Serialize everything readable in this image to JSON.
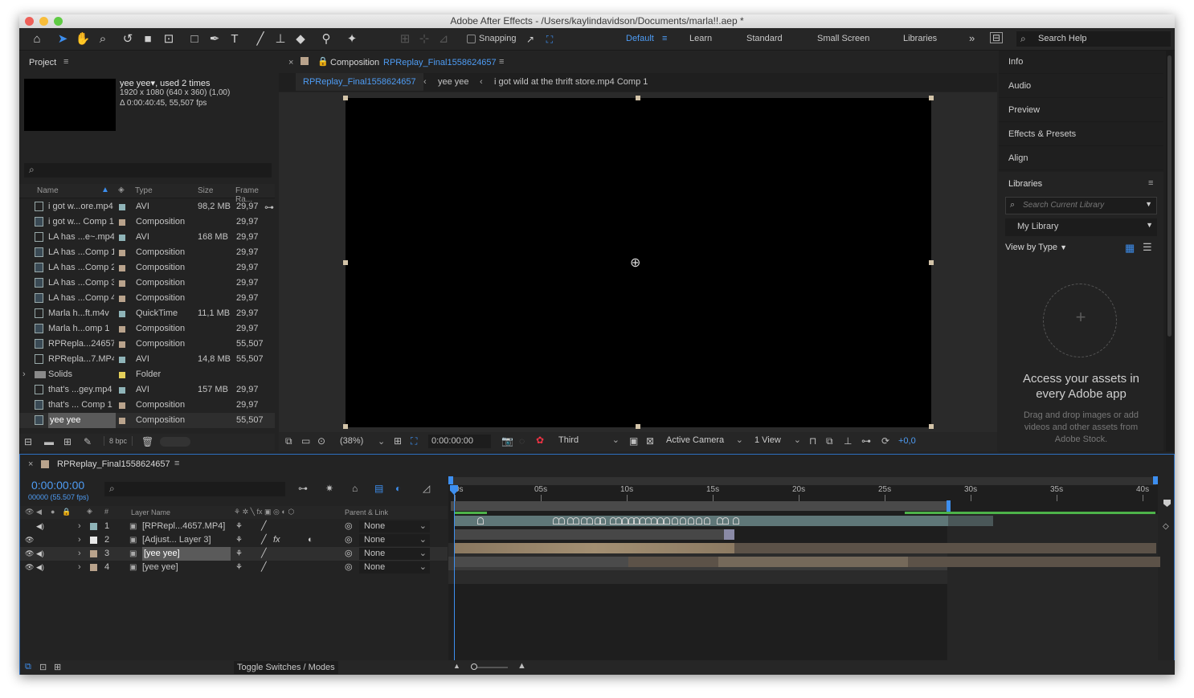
{
  "window": {
    "title": "Adobe After Effects - /Users/kaylindavidson/Documents/marla!!.aep *"
  },
  "toolbar": {
    "snapping_label": "Snapping",
    "workspaces": [
      "Default",
      "Learn",
      "Standard",
      "Small Screen",
      "Libraries"
    ],
    "search_help_placeholder": "Search Help"
  },
  "project": {
    "tab_label": "Project",
    "preview": {
      "name": "yee yee",
      "used": ", used 2 times",
      "dims": "1920 x 1080  (640 x 360) (1,00)",
      "duration": "Δ 0:00:40:45, 55,507 fps"
    },
    "search_placeholder": "",
    "columns": [
      "Name",
      "Type",
      "Size",
      "Frame Ra..."
    ],
    "items": [
      {
        "name": "i got w...ore.mp4",
        "type": "AVI",
        "size": "98,2 MB",
        "fps": "29,97",
        "swatch": "#8fb4b8"
      },
      {
        "name": "i got w... Comp 1",
        "type": "Composition",
        "size": "",
        "fps": "29,97",
        "swatch": "#b9a38c"
      },
      {
        "name": "LA has ...e~.mp4",
        "type": "AVI",
        "size": "168 MB",
        "fps": "29,97",
        "swatch": "#8fb4b8"
      },
      {
        "name": "LA has ...Comp 1",
        "type": "Composition",
        "size": "",
        "fps": "29,97",
        "swatch": "#b9a38c"
      },
      {
        "name": "LA has ...Comp 2",
        "type": "Composition",
        "size": "",
        "fps": "29,97",
        "swatch": "#b9a38c"
      },
      {
        "name": "LA has ...Comp 3",
        "type": "Composition",
        "size": "",
        "fps": "29,97",
        "swatch": "#b9a38c"
      },
      {
        "name": "LA has ...Comp 4",
        "type": "Composition",
        "size": "",
        "fps": "29,97",
        "swatch": "#b9a38c"
      },
      {
        "name": "Marla h...ft.m4v",
        "type": "QuickTime",
        "size": "11,1 MB",
        "fps": "29,97",
        "swatch": "#8fb4b8"
      },
      {
        "name": "Marla h...omp 1",
        "type": "Composition",
        "size": "",
        "fps": "29,97",
        "swatch": "#b9a38c"
      },
      {
        "name": "RPRepla...24657",
        "type": "Composition",
        "size": "",
        "fps": "55,507",
        "swatch": "#b9a38c"
      },
      {
        "name": "RPRepla...7.MP4",
        "type": "AVI",
        "size": "14,8 MB",
        "fps": "55,507",
        "swatch": "#8fb4b8"
      },
      {
        "name": "Solids",
        "type": "Folder",
        "size": "",
        "fps": "",
        "swatch": "#e3cf5a"
      },
      {
        "name": "that's ...gey.mp4",
        "type": "AVI",
        "size": "157 MB",
        "fps": "29,97",
        "swatch": "#8fb4b8"
      },
      {
        "name": "that's ... Comp 1",
        "type": "Composition",
        "size": "",
        "fps": "29,97",
        "swatch": "#b9a38c"
      },
      {
        "name": "yee yee",
        "type": "Composition",
        "size": "",
        "fps": "55,507",
        "swatch": "#b9a38c"
      }
    ],
    "bpc": "8 bpc"
  },
  "composition": {
    "tab_prefix": "Composition",
    "tab_name": "RPReplay_Final1558624657",
    "breadcrumbs": [
      "RPReplay_Final1558624657",
      "yee yee",
      "i got wild at the thrift store.mp4 Comp 1"
    ],
    "zoom": "(38%)",
    "timecode": "0:00:00:00",
    "resolution": "Third",
    "camera": "Active Camera",
    "view": "1 View",
    "exposure": "+0,0"
  },
  "right_panels": {
    "tabs": [
      "Info",
      "Audio",
      "Preview",
      "Effects & Presets",
      "Align"
    ],
    "libraries": {
      "title": "Libraries",
      "search_placeholder": "Search Current Library",
      "library_name": "My Library",
      "view_by": "View by Type",
      "headline": "Access your assets in every Adobe app",
      "body": "Drag and drop images or add videos and other assets from Adobe Stock."
    }
  },
  "timeline": {
    "tab_name": "RPReplay_Final1558624657",
    "timecode": "0:00:00:00",
    "frame_info": "00000 (55.507 fps)",
    "columns": {
      "layer_name": "Layer Name",
      "parent": "Parent & Link"
    },
    "ruler_labels": [
      "0s",
      "05s",
      "10s",
      "15s",
      "20s",
      "25s",
      "30s",
      "35s",
      "40s"
    ],
    "layers": [
      {
        "num": "1",
        "name": "[RPRepl...4657.MP4]",
        "parent": "None",
        "label_color": "#8fb4b8"
      },
      {
        "num": "2",
        "name": "[Adjust... Layer 3]",
        "parent": "None",
        "label_color": "#e8e8e8"
      },
      {
        "num": "3",
        "name": "[yee yee]",
        "parent": "None",
        "label_color": "#b9a38c"
      },
      {
        "num": "4",
        "name": "[yee yee]",
        "parent": "None",
        "label_color": "#b9a38c"
      }
    ],
    "toggle_label": "Toggle Switches / Modes"
  }
}
